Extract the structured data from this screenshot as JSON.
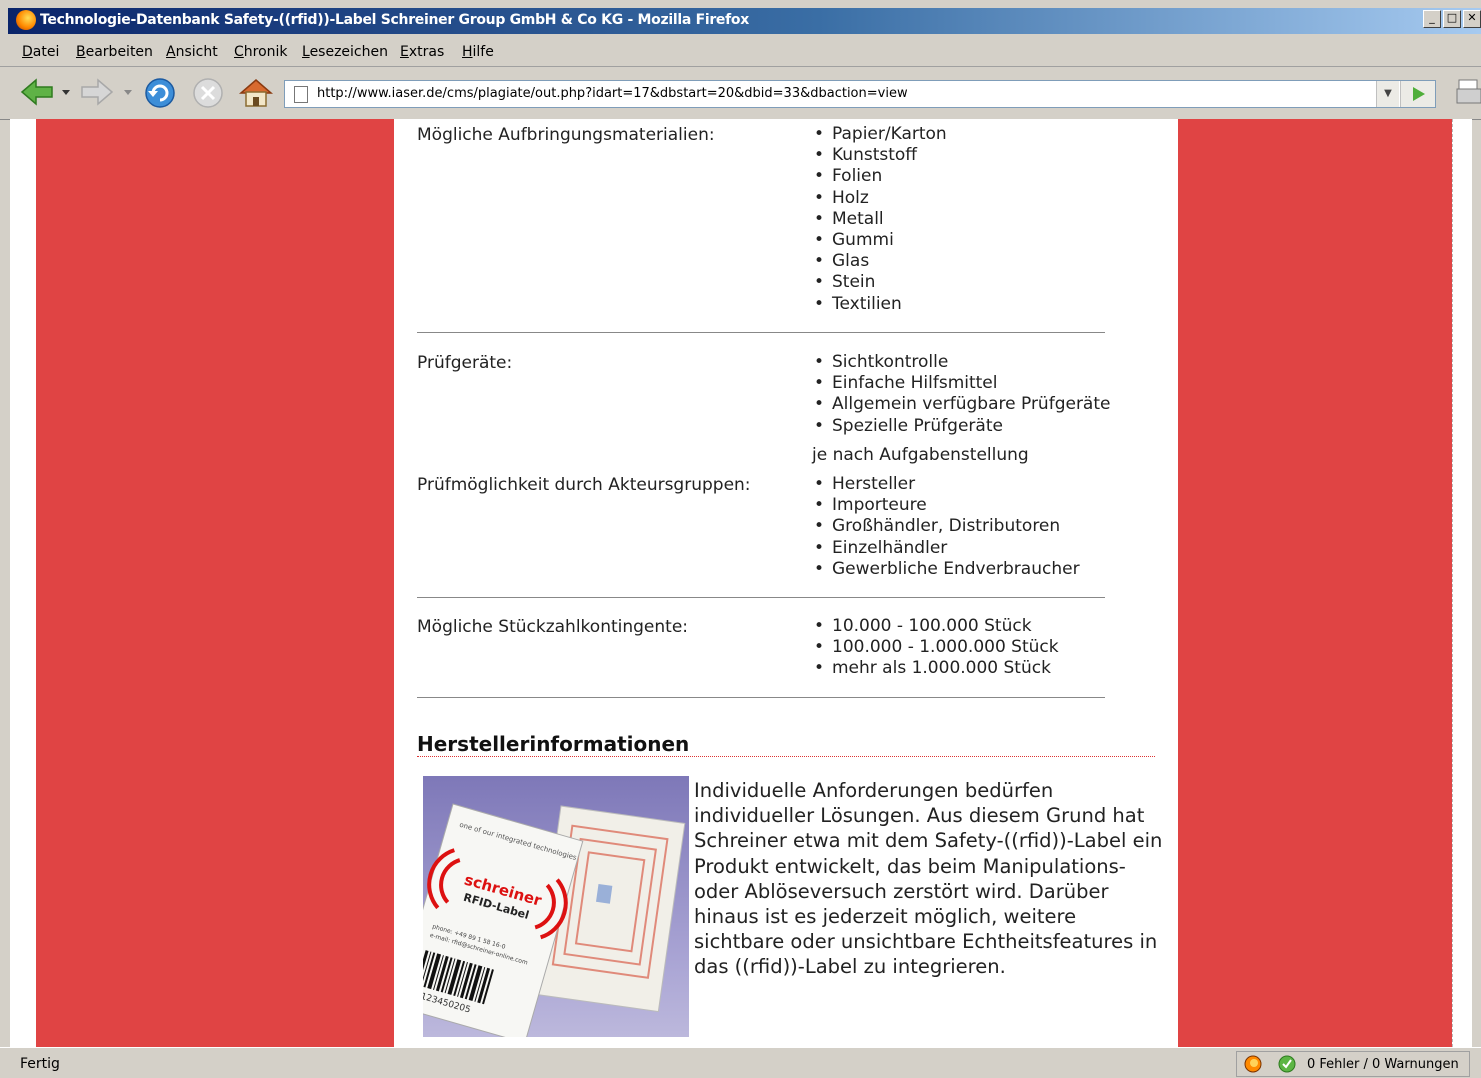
{
  "window": {
    "title": "Technologie-Datenbank Safety-((rfid))-Label Schreiner Group GmbH & Co KG - Mozilla Firefox"
  },
  "menu": [
    "Datei",
    "Bearbeiten",
    "Ansicht",
    "Chronik",
    "Lesezeichen",
    "Extras",
    "Hilfe"
  ],
  "toolbar": {
    "url": "http://www.iaser.de/cms/plagiate/out.php?idart=17&dbstart=20&dbid=33&dbaction=view"
  },
  "rows": {
    "materials": {
      "label": "Mögliche Aufbringungsmaterialien:",
      "items": [
        "Papier/Karton",
        "Kunststoff",
        "Folien",
        "Holz",
        "Metall",
        "Gummi",
        "Glas",
        "Stein",
        "Textilien"
      ]
    },
    "devices": {
      "label": "Prüfgeräte:",
      "items": [
        "Sichtkontrolle",
        "Einfache Hilfsmittel",
        "Allgemein verfügbare Prüfgeräte",
        "Spezielle Prüfgeräte"
      ],
      "note": "je nach Aufgabenstellung"
    },
    "actors": {
      "label": "Prüfmöglichkeit durch Akteursgruppen:",
      "items": [
        "Hersteller",
        "Importeure",
        "Großhändler, Distributoren",
        "Einzelhändler",
        "Gewerbliche Endverbraucher"
      ]
    },
    "quantities": {
      "label": "Mögliche Stückzahlkontingente:",
      "items": [
        "10.000 - 100.000 Stück",
        "100.000 - 1.000.000 Stück",
        "mehr als 1.000.000 Stück"
      ]
    }
  },
  "manufacturer": {
    "heading": "Herstellerinformationen",
    "image": {
      "top_text": "one of our integrated technologies",
      "brand": "schreiner",
      "product": "RFID-Label",
      "phone": "phone: +49 89 1 58 16-0",
      "email": "e-mail: rfid@schreiner-online.com",
      "barcode": "123450205"
    },
    "description": "Individuelle Anforderungen bedürfen individueller Lösungen. Aus diesem Grund hat Schreiner etwa mit dem Safety-((rfid))-Label ein Produkt entwickelt, das beim Manipulations- oder Ablöseversuch zerstört wird. Darüber hinaus ist es jederzeit möglich, weitere sichtbare oder unsichtbare Echtheitsfeatures in das ((rfid))-Label zu integrieren."
  },
  "status": {
    "left": "Fertig",
    "right": "0 Fehler / 0 Warnungen"
  },
  "colors": {
    "page_side": "#e04444",
    "title_bar": "#0a246a",
    "section_rule": "#dd3333"
  }
}
